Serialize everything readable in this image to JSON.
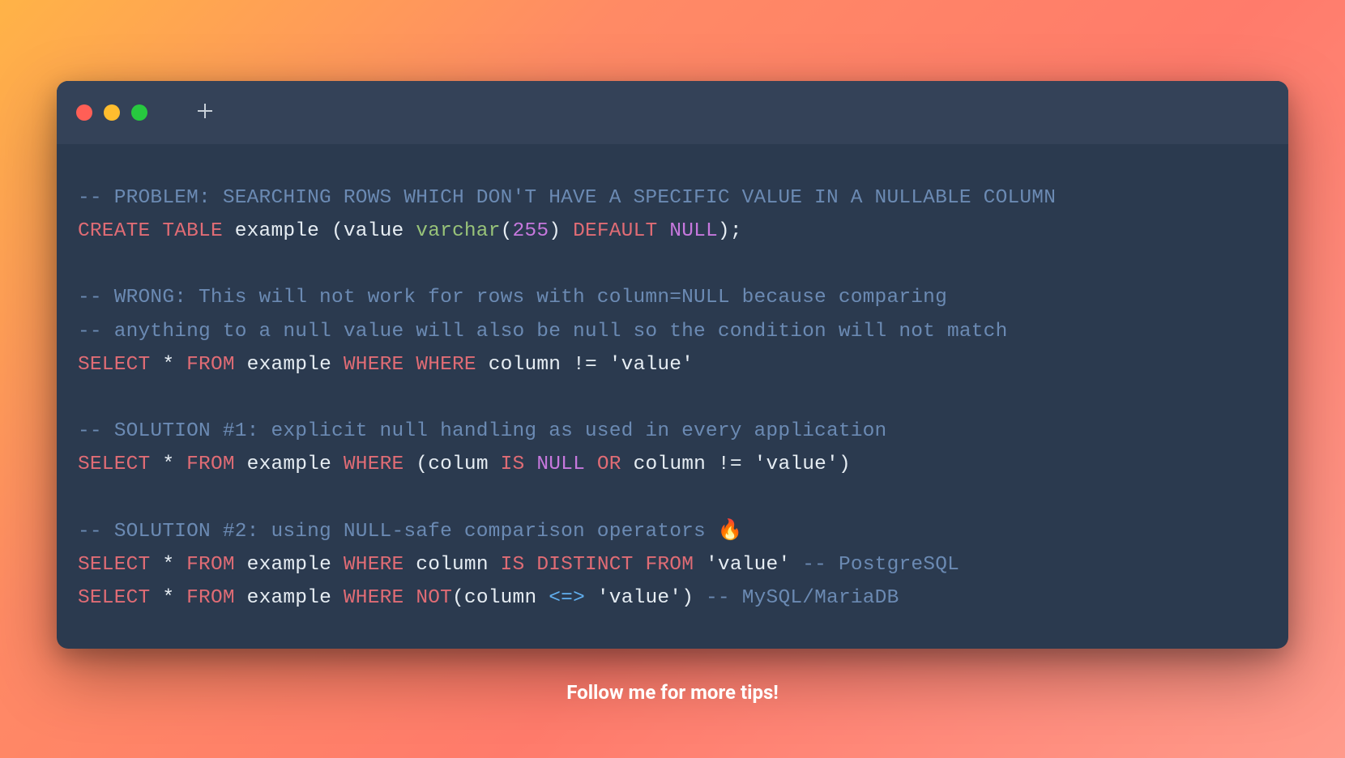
{
  "lines": {
    "l1": "-- PROBLEM: SEARCHING ROWS WHICH DON'T HAVE A SPECIFIC VALUE IN A NULLABLE COLUMN",
    "l2": {
      "k1": "CREATE",
      "k2": "TABLE",
      "t1": " example (value ",
      "ty": "varchar",
      "p1": "(",
      "n1": "255",
      "p2": ") ",
      "k3": "DEFAULT",
      "sp": " ",
      "nu": "NULL",
      "p3": ");"
    },
    "l4": "-- WRONG: This will not work for rows with column=NULL because comparing",
    "l5": "-- anything to a null value will also be null so the condition will not match",
    "l6": {
      "k1": "SELECT",
      "t1": " * ",
      "k2": "FROM",
      "t2": " example ",
      "k3": "WHERE",
      "sp": " ",
      "k4": "WHERE",
      "t3": " column != ",
      "s1": "'value'"
    },
    "l8": "-- SOLUTION #1: explicit null handling as used in every application",
    "l9": {
      "k1": "SELECT",
      "t1": " * ",
      "k2": "FROM",
      "t2": " example ",
      "k3": "WHERE",
      "t3": " (colum ",
      "k4": "IS",
      "sp": " ",
      "nu": "NULL",
      "sp2": " ",
      "k5": "OR",
      "t4": " column != ",
      "s1": "'value'",
      "p1": ")"
    },
    "l11": "-- SOLUTION #2: using NULL-safe comparison operators 🔥",
    "l12": {
      "k1": "SELECT",
      "t1": " * ",
      "k2": "FROM",
      "t2": " example ",
      "k3": "WHERE",
      "t3": " column ",
      "k4": "IS",
      "sp": " ",
      "k5": "DISTINCT",
      "sp2": " ",
      "k6": "FROM",
      "sp3": " ",
      "s1": "'value'",
      "sp4": " ",
      "c1": "-- PostgreSQL"
    },
    "l13": {
      "k1": "SELECT",
      "t1": " * ",
      "k2": "FROM",
      "t2": " example ",
      "k3": "WHERE",
      "sp": " ",
      "k4": "NOT",
      "p1": "(column ",
      "op": "<=>",
      "sp2": " ",
      "s1": "'value'",
      "p2": ") ",
      "c1": "-- MySQL/MariaDB"
    }
  },
  "footer": "Follow me for more tips!"
}
